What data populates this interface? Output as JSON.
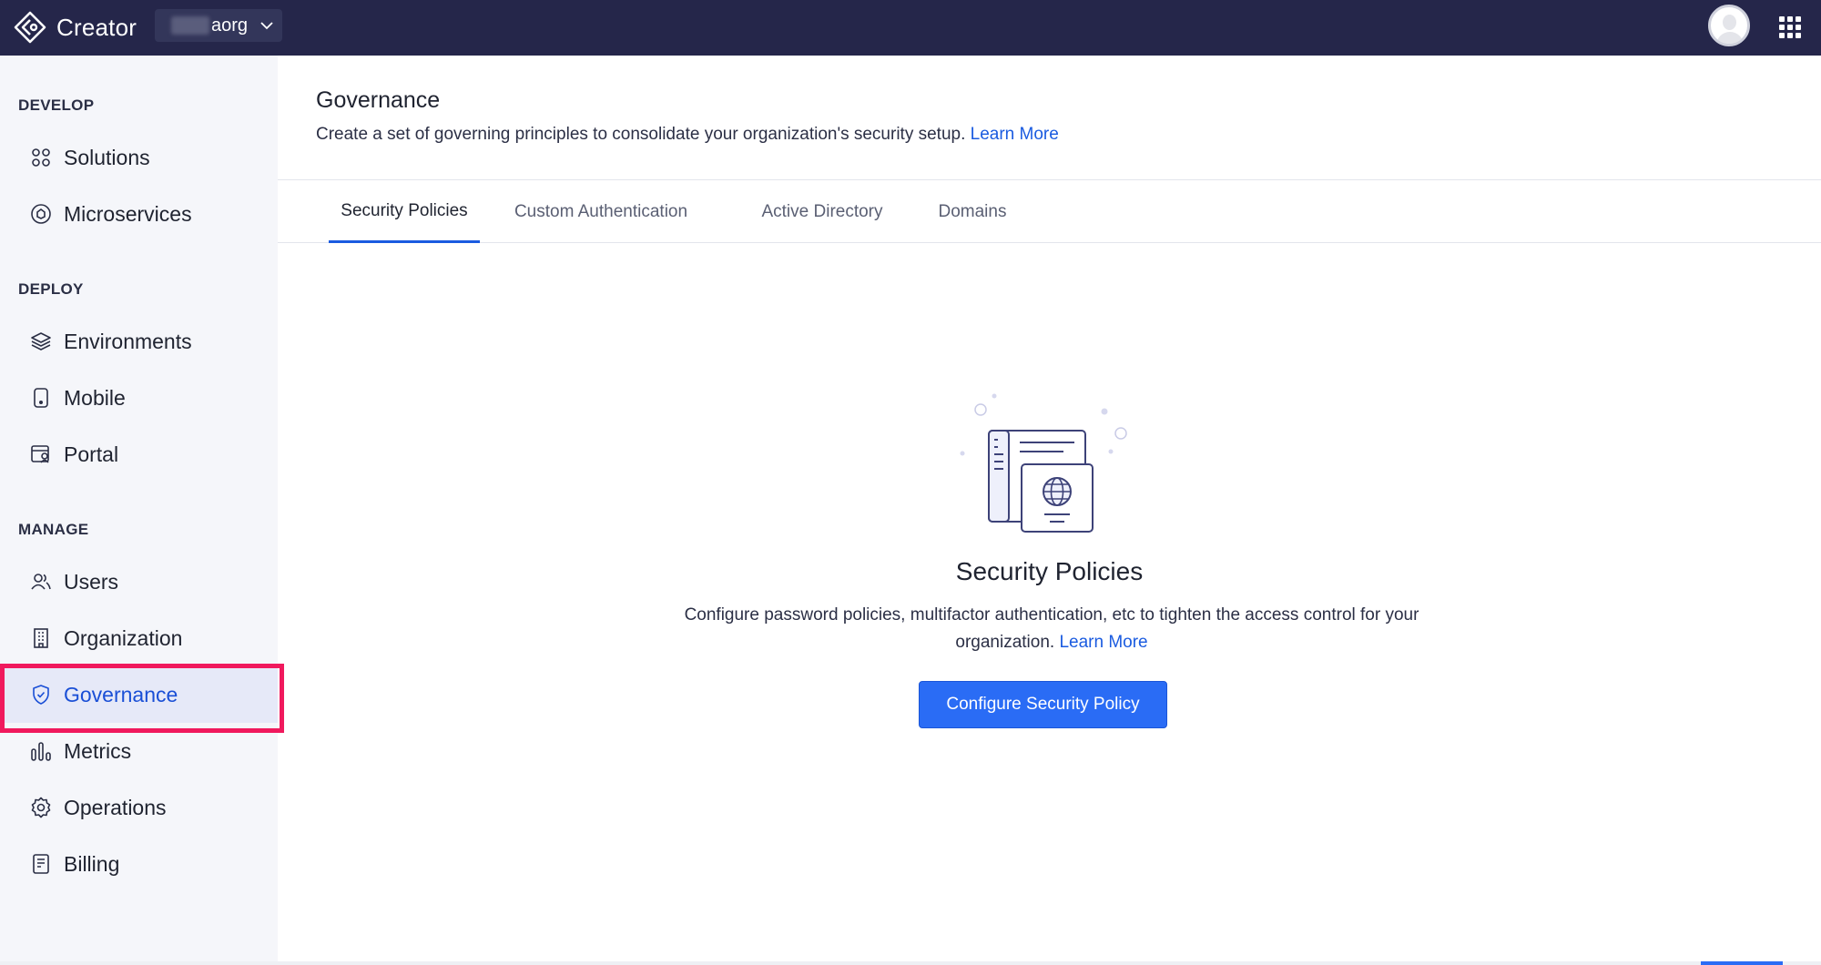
{
  "app": {
    "name": "Creator",
    "org_name": "aorg"
  },
  "sidebar": {
    "sections": [
      {
        "title": "DEVELOP",
        "items": [
          {
            "label": "Solutions",
            "icon": "grid-circles-icon"
          },
          {
            "label": "Microservices",
            "icon": "microservices-icon"
          }
        ]
      },
      {
        "title": "DEPLOY",
        "items": [
          {
            "label": "Environments",
            "icon": "layers-icon"
          },
          {
            "label": "Mobile",
            "icon": "mobile-icon"
          },
          {
            "label": "Portal",
            "icon": "portal-icon"
          }
        ]
      },
      {
        "title": "MANAGE",
        "items": [
          {
            "label": "Users",
            "icon": "users-icon"
          },
          {
            "label": "Organization",
            "icon": "building-icon"
          },
          {
            "label": "Governance",
            "icon": "shield-check-icon",
            "active": true
          },
          {
            "label": "Metrics",
            "icon": "bar-chart-icon"
          },
          {
            "label": "Operations",
            "icon": "gear-icon"
          },
          {
            "label": "Billing",
            "icon": "receipt-icon"
          }
        ]
      }
    ]
  },
  "header": {
    "title": "Governance",
    "description": "Create a set of governing principles to consolidate your organization's security setup.",
    "learn_more": "Learn More"
  },
  "tabs": [
    {
      "label": "Security Policies",
      "active": true
    },
    {
      "label": "Custom Authentication"
    },
    {
      "label": "Active Directory"
    },
    {
      "label": "Domains"
    }
  ],
  "empty_state": {
    "title": "Security Policies",
    "description": "Configure password policies, multifactor authentication, etc to tighten the access control for your organization.",
    "learn_more": "Learn More",
    "button": "Configure Security Policy"
  },
  "colors": {
    "topbar": "#25264a",
    "accent": "#2a6cf5",
    "highlight": "#f0195d"
  }
}
